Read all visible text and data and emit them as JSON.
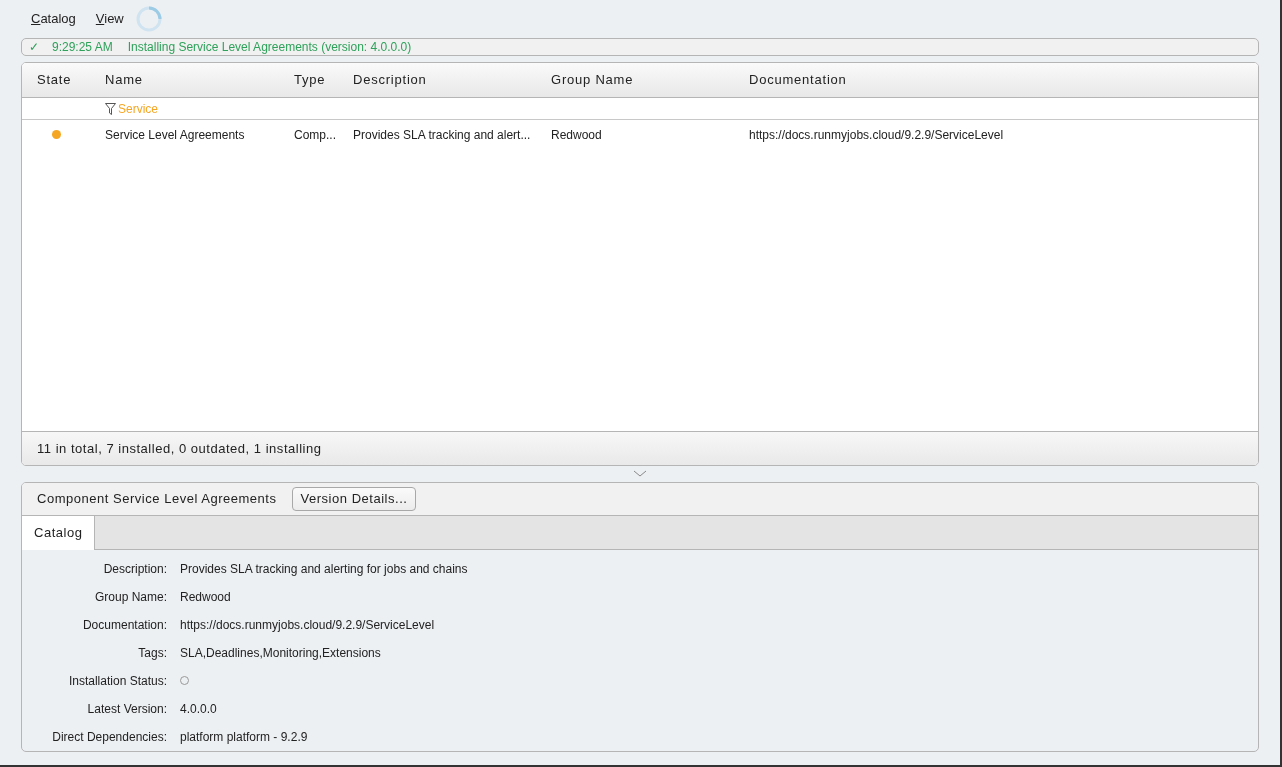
{
  "menu": [
    {
      "label": "Catalog"
    },
    {
      "label": "View"
    }
  ],
  "busy": true,
  "status": {
    "icon": "✓",
    "time": "9:29:25 AM",
    "message": "Installing Service Level Agreements (version: 4.0.0.0)"
  },
  "table": {
    "columns": [
      "State",
      "Name",
      "Type",
      "Description",
      "Group Name",
      "Documentation"
    ],
    "filter": {
      "text": "Service"
    },
    "rows": [
      {
        "color": "#f5a623",
        "selected": false,
        "name": "Service Level Agreements",
        "type": "Comp...",
        "description": "Provides SLA tracking and alert...",
        "group_name": "Redwood",
        "documentation": "https://docs.runmyjobs.cloud/9.2.9/ServiceLevel"
      }
    ],
    "footer": "11 in total, 7 installed, 0 outdated, 1 installing"
  },
  "details": {
    "title": "Component Service Level Agreements",
    "button": "Version Details...",
    "tabs": [
      {
        "label": "Catalog",
        "selected": true
      }
    ],
    "fields": [
      {
        "label": "Description:",
        "kind": "text",
        "value": "Provides SLA tracking and alerting for jobs and chains"
      },
      {
        "label": "Group Name:",
        "kind": "text",
        "value": "Redwood"
      },
      {
        "label": "Documentation:",
        "kind": "text",
        "value": "https://docs.runmyjobs.cloud/9.2.9/ServiceLevel"
      },
      {
        "label": "Tags:",
        "kind": "text",
        "value": "SLA,Deadlines,Monitoring,Extensions"
      },
      {
        "label": "Installation Status:",
        "kind": "status",
        "installed": false
      },
      {
        "label": "Latest Version:",
        "kind": "text",
        "value": "4.0.0.0"
      },
      {
        "label": "Direct Dependencies:",
        "kind": "text",
        "value": "platform platform - 9.2.9"
      }
    ]
  }
}
